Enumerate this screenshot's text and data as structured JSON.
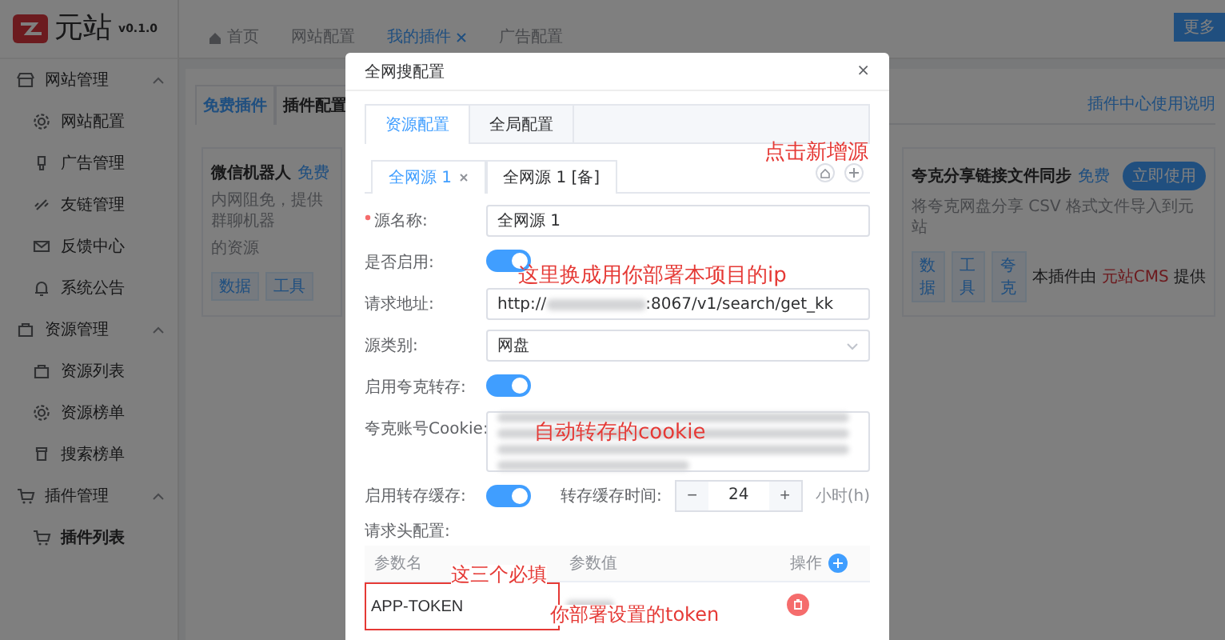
{
  "sidebar": {
    "logo_text": "元站",
    "version": "v0.1.0",
    "groups": [
      {
        "label": "网站管理",
        "expanded": true,
        "children": [
          {
            "label": "网站配置",
            "selected": false
          },
          {
            "label": "广告管理",
            "selected": false
          },
          {
            "label": "友链管理",
            "selected": false
          },
          {
            "label": "反馈中心",
            "selected": false
          },
          {
            "label": "系统公告",
            "selected": false
          }
        ]
      },
      {
        "label": "资源管理",
        "expanded": true,
        "children": [
          {
            "label": "资源列表",
            "selected": false
          },
          {
            "label": "资源榜单",
            "selected": false
          },
          {
            "label": "搜索榜单",
            "selected": false
          }
        ]
      },
      {
        "label": "插件管理",
        "expanded": true,
        "children": [
          {
            "label": "插件列表",
            "selected": true
          }
        ]
      }
    ]
  },
  "top_tabs": [
    {
      "label": "首页",
      "selected": false,
      "closable": false
    },
    {
      "label": "网站配置",
      "selected": false,
      "closable": false
    },
    {
      "label": "我的插件",
      "selected": true,
      "closable": true
    },
    {
      "label": "广告配置",
      "selected": false,
      "closable": false
    }
  ],
  "more_button": "更多",
  "plugin_tabs": [
    {
      "label": "免费插件",
      "selected": true
    },
    {
      "label": "插件配置",
      "selected": false
    }
  ],
  "help_link": "插件中心使用说明",
  "plugins": [
    {
      "name": "微信机器人",
      "badge": "免费",
      "description": [
        "内网阻免，提供群聊机器",
        "的资源"
      ],
      "tags": [
        "数据",
        "工具"
      ]
    },
    {
      "name": "夸克分享链接文件同步",
      "badge": "免费",
      "description": [
        "将夸克网盘分享 CSV 格式文件导入到元站"
      ],
      "tags": [
        "数据",
        "工具",
        "夸克"
      ],
      "button": "立即使用",
      "footer": {
        "prefix": "本插件由",
        "brand": "元站CMS",
        "suffix": "提供"
      }
    }
  ],
  "modal": {
    "title": "全网搜配置",
    "close": "×",
    "tabs": [
      {
        "label": "资源配置",
        "selected": true
      },
      {
        "label": "全局配置",
        "selected": false
      }
    ],
    "source_tabs": [
      {
        "label": "全网源 1",
        "selected": true,
        "closable": true
      },
      {
        "label": "全网源 1 [备]",
        "selected": false,
        "closable": false
      }
    ],
    "form": {
      "name": {
        "label": "源名称:",
        "required": true,
        "value": "全网源 1"
      },
      "enabled": {
        "label": "是否启用:",
        "on": true
      },
      "url": {
        "label": "请求地址:",
        "prefix": "http://",
        "suffix": ":8067/v1/search/get_kk"
      },
      "category": {
        "label": "源类别:",
        "value": "网盘"
      },
      "quark_save": {
        "label": "启用夸克转存:",
        "on": true
      },
      "cookie": {
        "label": "夸克账号Cookie:"
      },
      "cache": {
        "label": "启用转存缓存:",
        "on": true
      },
      "cache_time": {
        "label": "转存缓存时间:",
        "minus": "−",
        "value": "24",
        "plus": "+",
        "unit": "小时(h)"
      },
      "headers": {
        "label": "请求头配置:",
        "columns": [
          "参数名",
          "参数值",
          "操作"
        ],
        "rows": [
          {
            "name": "APP-TOKEN",
            "highlighted": true
          }
        ]
      }
    }
  },
  "annotations": [
    {
      "text": "点击新增源"
    },
    {
      "text": "这里换成用你部署本项目的ip"
    },
    {
      "text": "自动转存的cookie"
    },
    {
      "text": "这三个必填"
    },
    {
      "text": "你部署设置的token"
    }
  ]
}
